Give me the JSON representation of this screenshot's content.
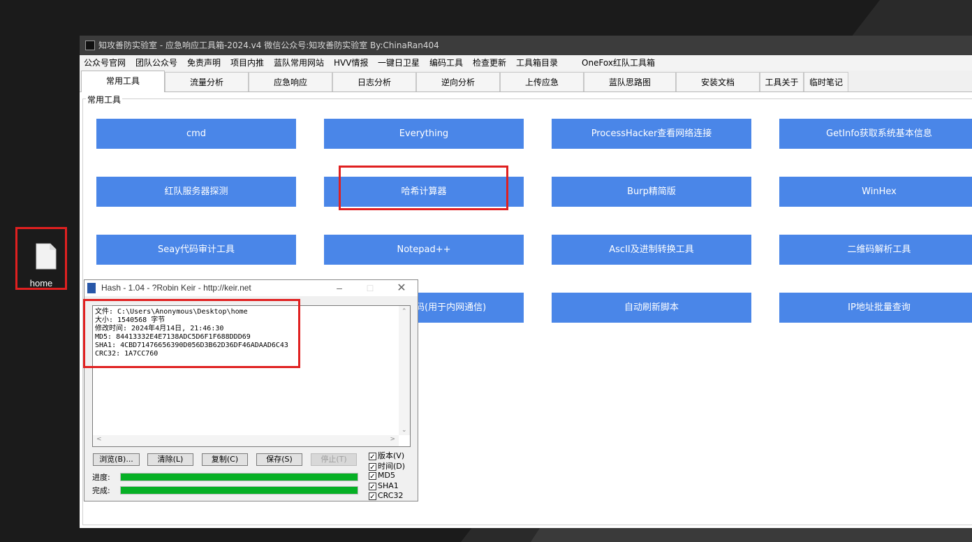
{
  "desktop": {
    "file_icon_label": "home"
  },
  "app": {
    "title": "知攻善防实验室 - 应急响应工具箱-2024.v4    微信公众号:知攻善防实验室    By:ChinaRan404",
    "menu": [
      "公众号官网",
      "团队公众号",
      "免责声明",
      "项目内推",
      "蓝队常用网站",
      "HVV情报",
      "一键日卫星",
      "编码工具",
      "检查更新",
      "工具箱目录",
      "OneFox红队工具箱"
    ],
    "tabs": [
      "常用工具",
      "流量分析",
      "应急响应",
      "日志分析",
      "逆向分析",
      "上传应急",
      "蓝队思路图",
      "安装文档",
      "工具关于",
      "临时笔记"
    ],
    "active_tab": "常用工具",
    "group_label": "常用工具",
    "tool_buttons": [
      [
        "cmd",
        "Everything",
        "ProcessHacker查看网络连接",
        "GetInfo获取系统基本信息"
      ],
      [
        "红队服务器探测",
        "哈希计算器",
        "Burp精简版",
        "WinHex"
      ],
      [
        "Seay代码审计工具",
        "Notepad++",
        "AscII及进制转换工具",
        "二维码解析工具"
      ],
      [
        "码(用于内网通信)",
        "",
        "自动刷新脚本",
        "IP地址批量查询"
      ]
    ],
    "highlight_color": "#e02020",
    "button_color": "#4a86e8"
  },
  "hash_window": {
    "title": "Hash - 1.04 - ?Robin Keir - http://keir.net",
    "output_lines": [
      "文件: C:\\Users\\Anonymous\\Desktop\\home",
      "大小: 1540568 字节",
      "修改时间: 2024年4月14日, 21:46:30",
      "MD5: 84413332E4E7138ADC5D6F1F688DDD69",
      "SHA1: 4CBD71476656390D056D3B62D36DF46ADAAD6C43",
      "CRC32: 1A7CC760"
    ],
    "buttons": {
      "browse": "浏览(B)...",
      "clear": "清除(L)",
      "copy": "复制(C)",
      "save": "保存(S)",
      "stop": "停止(T)"
    },
    "progress_label": "进度:",
    "complete_label": "完成:",
    "progress_value": 1.0,
    "complete_value": 1.0,
    "options": [
      {
        "label": "版本(V)",
        "checked": true
      },
      {
        "label": "时间(D)",
        "checked": true
      },
      {
        "label": "MD5",
        "checked": true
      },
      {
        "label": "SHA1",
        "checked": true
      },
      {
        "label": "CRC32",
        "checked": true
      }
    ]
  }
}
